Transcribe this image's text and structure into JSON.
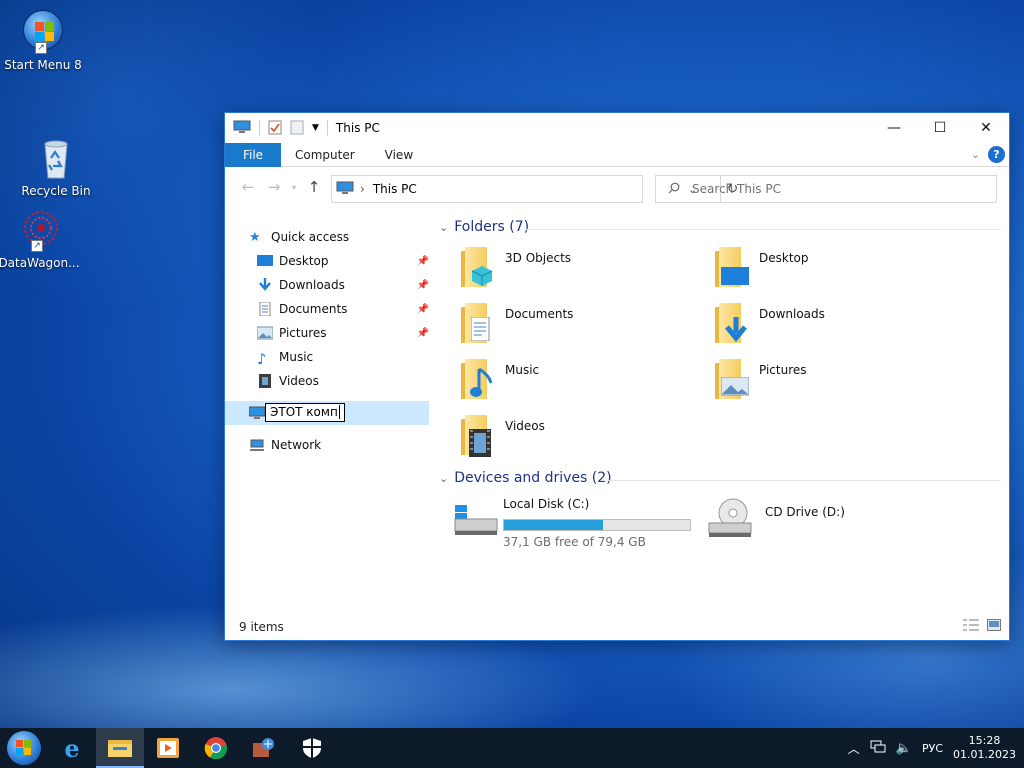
{
  "desktop": {
    "icons": [
      {
        "label": "Start Menu 8"
      },
      {
        "label": "Recycle Bin"
      },
      {
        "label": "DataWagon..."
      }
    ]
  },
  "window": {
    "title": "This PC",
    "ribbon_tabs": {
      "file": "File",
      "computer": "Computer",
      "view": "View"
    },
    "address": {
      "path": "This PC"
    },
    "search": {
      "placeholder": "Search This PC"
    },
    "nav": {
      "quick_access": "Quick access",
      "items": [
        {
          "label": "Desktop"
        },
        {
          "label": "Downloads"
        },
        {
          "label": "Documents"
        },
        {
          "label": "Pictures"
        },
        {
          "label": "Music"
        },
        {
          "label": "Videos"
        }
      ],
      "rename_value": "ЭТОТ комп",
      "network": "Network"
    },
    "groups": {
      "folders": "Folders (7)",
      "devices": "Devices and drives (2)"
    },
    "folders": [
      {
        "label": "3D Objects"
      },
      {
        "label": "Desktop"
      },
      {
        "label": "Documents"
      },
      {
        "label": "Downloads"
      },
      {
        "label": "Music"
      },
      {
        "label": "Pictures"
      },
      {
        "label": "Videos"
      }
    ],
    "drives": [
      {
        "label": "Local Disk (C:)",
        "free_text": "37,1 GB free of 79,4 GB",
        "used_fraction": 0.533
      },
      {
        "label": "CD Drive (D:)"
      }
    ],
    "status": "9 items"
  },
  "taskbar": {
    "language": "РУС",
    "time": "15:28",
    "date": "01.01.2023"
  },
  "colors": {
    "accent": "#1979ca",
    "selection": "#cce8ff",
    "drive_fill": "#26a0da"
  }
}
